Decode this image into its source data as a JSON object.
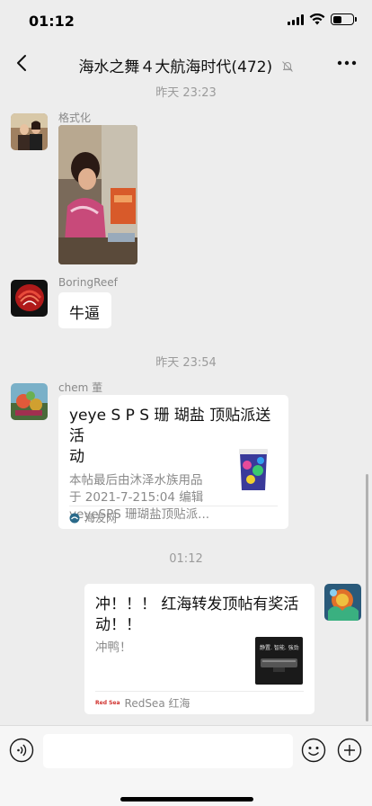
{
  "status_bar": {
    "time": "01:12",
    "battery_level": 0.45
  },
  "nav": {
    "title": "海水之舞４大航海时代(472)"
  },
  "messages": {
    "time_1": "昨天 23:23",
    "msg1": {
      "sender": "格式化"
    },
    "msg2": {
      "sender": "BoringReef",
      "text": "牛逼"
    },
    "time_2": "昨天 23:54",
    "msg3": {
      "sender": "chem 董",
      "title_line1": "yeye S P S 珊 瑚盐 顶贴派送活",
      "title_line2": "动",
      "desc_line1": "本帖最后由沐泽水族用品",
      "desc_line2": "于 2021-7-215:04 编辑",
      "desc_line3": "yeyeSPS 珊瑚盐顶贴派...",
      "source": "海友网"
    },
    "time_3": "01:12",
    "msg4": {
      "title_line1": "冲！！！ 红海转发顶帖有奖活",
      "title_line2": "动！！",
      "desc": "冲鸭！",
      "thumb_text": "静置. 智能. 強劲",
      "source_logo": "Red Sea",
      "source": "RedSea 红海"
    }
  },
  "colors": {
    "background": "#ededed",
    "bubble": "#ffffff",
    "time_label": "#9b9b9b"
  }
}
